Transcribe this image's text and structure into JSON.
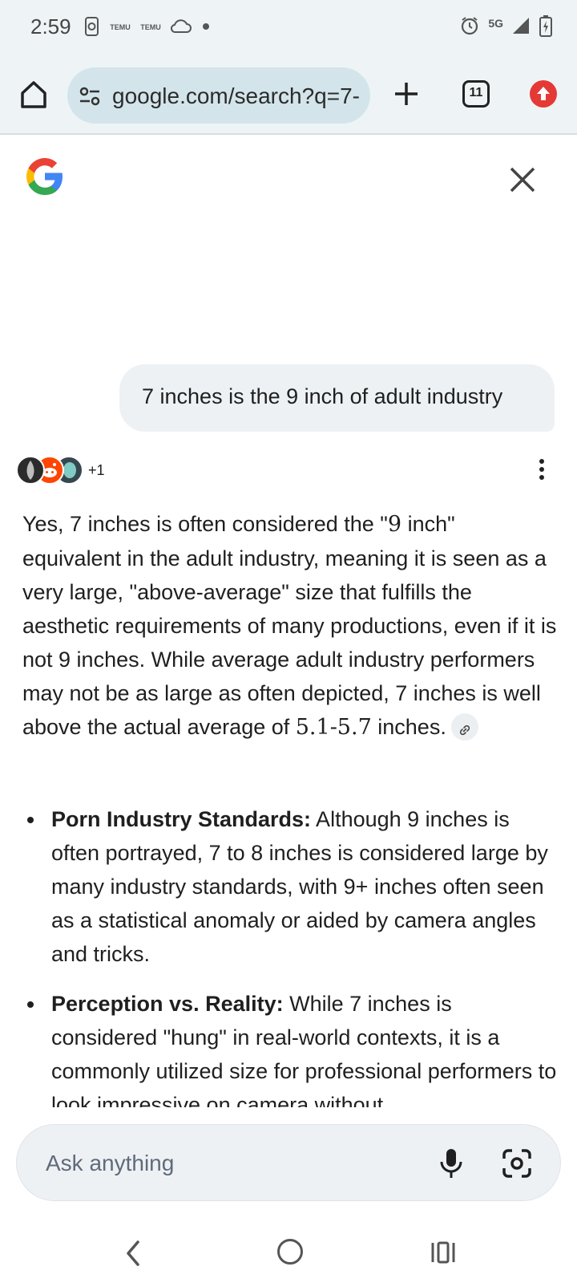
{
  "status_bar": {
    "time": "2:59",
    "network": "5G",
    "temu_label": "TEMU",
    "icons": [
      "screen-record-icon",
      "temu-icon",
      "temu-icon",
      "cloud-icon",
      "dot-icon",
      "alarm-icon",
      "signal-icon",
      "battery-charging-icon"
    ]
  },
  "browser": {
    "url": "google.com/search?q=7-",
    "tab_count": "11",
    "accent_color": "#e53935"
  },
  "conversation": {
    "query": "7 inches is the 9 inch of adult industry",
    "sources_more": "+1",
    "answer": {
      "p1": "Yes, 7 inches is often considered the \"",
      "p1_serif": "9",
      "p2": " inch\" equivalent in the adult industry, meaning it is seen as a very large, \"above-average\" size that fulfills the aesthetic requirements of many productions, even if it is not 9 inches. While average adult industry performers may not be as large as often depicted, 7 inches is well above the actual average of ",
      "p2_serif": "5.1-5.7",
      "p3": " inches."
    },
    "bullets": [
      {
        "title": "Porn Industry Standards:",
        "text": " Although 9 inches is often portrayed, 7 to 8 inches is considered large by many industry standards, with 9+ inches often seen as a statistical anomaly or aided by camera angles and tricks."
      },
      {
        "title": "Perception vs. Reality:",
        "text": " While 7 inches is considered \"hung\" in real-world contexts, it is a commonly utilized size for professional performers to look impressive on camera without"
      }
    ]
  },
  "ask_bar": {
    "placeholder": "Ask anything"
  }
}
